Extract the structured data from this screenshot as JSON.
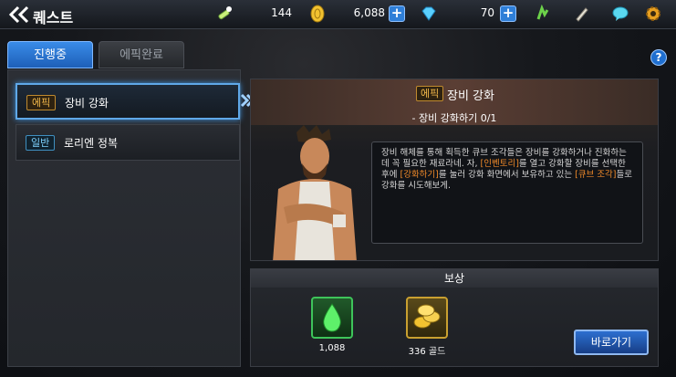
{
  "header": {
    "title": "퀘스트",
    "stamina": "144",
    "gold": "6,088",
    "gems": "70"
  },
  "tabs": [
    {
      "label": "진행중",
      "active": true
    },
    {
      "label": "에픽완료",
      "active": false
    }
  ],
  "help_label": "?",
  "quests": [
    {
      "tag": "에픽",
      "name": "장비 강화",
      "selected": true
    },
    {
      "tag": "일반",
      "name": "로리엔 정복",
      "selected": false
    }
  ],
  "detail": {
    "badge": "에픽",
    "title": "장비 강화",
    "objective": "- 장비 강화하기 0/1",
    "desc_1": "장비 해체를 통해 획득한 큐브 조각들은 장비를 강화하거나 진화하는데 꼭 필요한 재료라네. 자, ",
    "desc_hl1": "[인벤토리]",
    "desc_2": "를 열고 강화할 장비를 선택한 후에 ",
    "desc_hl2": "[강화하기]",
    "desc_3": "를 눌러 강화 화면에서 보유하고 있는 ",
    "desc_hl3": "[큐브 조각]",
    "desc_4": "들로 강화를 시도해보게."
  },
  "reward": {
    "header": "보상",
    "items": [
      {
        "icon": "green-drop-icon",
        "label": "1,088"
      },
      {
        "icon": "gold-coins-icon",
        "label": "336 골드"
      }
    ],
    "goto_label": "바로가기"
  },
  "colors": {
    "accent": "#2f7fd8",
    "epic": "#f2b84a",
    "normal": "#7fd2ff",
    "highlight": "#f08a2a"
  }
}
